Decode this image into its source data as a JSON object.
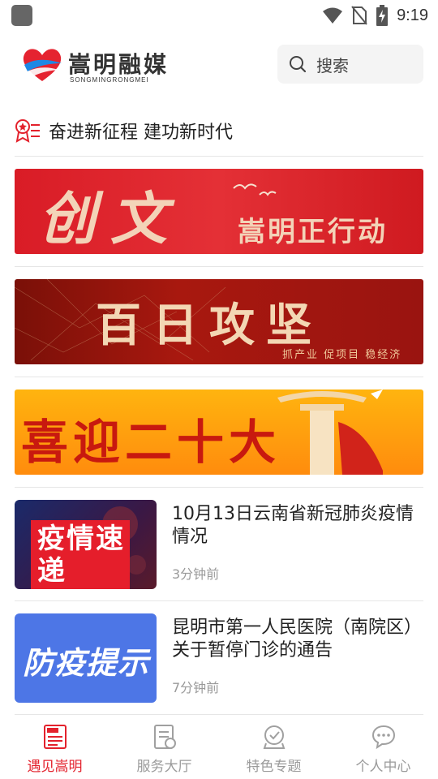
{
  "status_bar": {
    "time": "9:19"
  },
  "header": {
    "logo_title": "嵩明融媒",
    "logo_subtitle": "SONGMINGRONGMEI",
    "search_placeholder": "搜索"
  },
  "slogan": {
    "text": "奋进新征程 建功新时代"
  },
  "banners": [
    {
      "big_text": "创文",
      "small_text": "嵩明正行动"
    },
    {
      "big_text": "百日攻坚",
      "small_text": "抓产业 促项目 稳经济"
    },
    {
      "big_text": "喜迎二十大"
    }
  ],
  "news": [
    {
      "thumb_text": "疫情速递",
      "title": "10月13日云南省新冠肺炎疫情情况",
      "time": "3分钟前"
    },
    {
      "thumb_text": "防疫提示",
      "title": "昆明市第一人民医院（南院区）关于暂停门诊的通告",
      "time": "7分钟前"
    }
  ],
  "bottom_nav": [
    {
      "label": "遇见嵩明",
      "icon": "news-icon",
      "active": true
    },
    {
      "label": "服务大厅",
      "icon": "service-doc-icon",
      "active": false
    },
    {
      "label": "特色专题",
      "icon": "feature-topic-icon",
      "active": false
    },
    {
      "label": "个人中心",
      "icon": "chat-bubble-icon",
      "active": false
    }
  ],
  "colors": {
    "accent": "#e3212c",
    "inactive": "#9a9a9a"
  }
}
